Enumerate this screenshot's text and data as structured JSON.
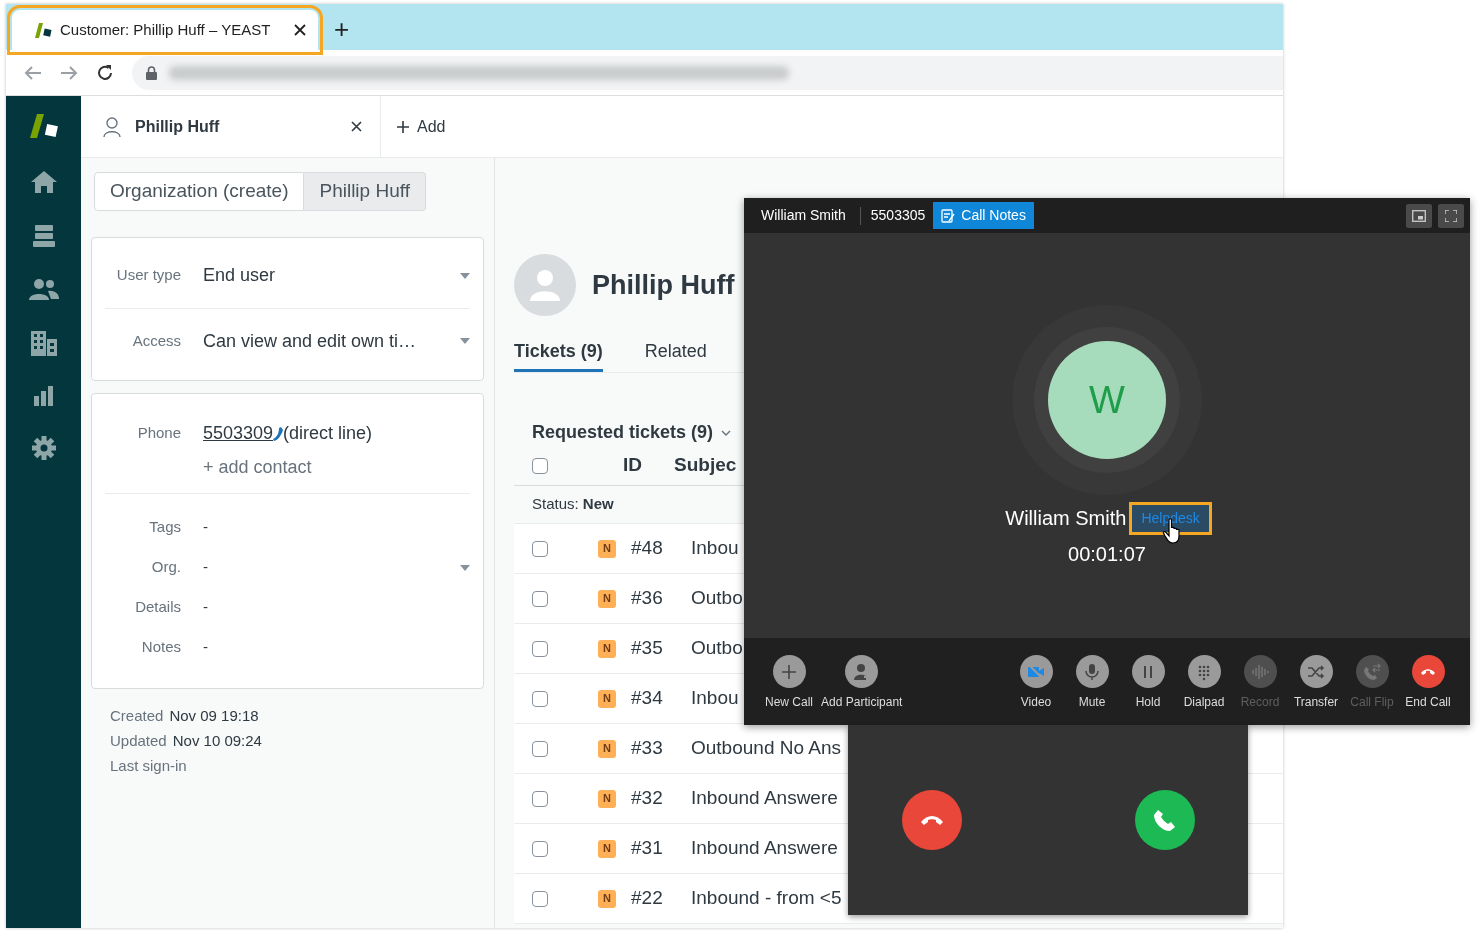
{
  "browser": {
    "tab": {
      "title": "Customer: Phillip Huff – YEAST",
      "highlighted": true
    },
    "new_tab": "+"
  },
  "header_tabs": [
    {
      "label": "Phillip Huff"
    }
  ],
  "add_tab": "Add",
  "breadcrumbs": [
    {
      "label": "Organization (create)",
      "selected": false
    },
    {
      "label": "Phillip Huff",
      "selected": true
    }
  ],
  "user_fields": [
    {
      "label": "User type",
      "value": "End user"
    },
    {
      "label": "Access",
      "value": "Can view and edit own ti…"
    }
  ],
  "contact": {
    "label": "Phone",
    "number": "5503309",
    "note": "(direct line)",
    "add": "+ add contact"
  },
  "details": [
    {
      "label": "Tags",
      "value": "-",
      "dropdown": false
    },
    {
      "label": "Org.",
      "value": "-",
      "dropdown": true
    },
    {
      "label": "Details",
      "value": "-",
      "dropdown": false
    },
    {
      "label": "Notes",
      "value": "-",
      "dropdown": false
    }
  ],
  "meta": [
    {
      "label": "Created",
      "value": "Nov 09 19:18"
    },
    {
      "label": "Updated",
      "value": "Nov 10 09:24"
    },
    {
      "label": "Last sign-in"
    }
  ],
  "profile": {
    "name": "Phillip Huff",
    "tabs": [
      {
        "label": "Tickets (9)",
        "selected": true
      },
      {
        "label": "Related",
        "selected": false
      }
    ]
  },
  "tickets": {
    "title": "Requested tickets (9)",
    "select_all_checked": false,
    "columns": [
      "ID",
      "Subjec"
    ],
    "group": {
      "label": "Status:",
      "value": "New"
    },
    "rows": [
      {
        "status": "N",
        "id": "#48",
        "subject": "Inbou",
        "checked": false
      },
      {
        "status": "N",
        "id": "#36",
        "subject": "Outbo",
        "checked": false
      },
      {
        "status": "N",
        "id": "#35",
        "subject": "Outbo",
        "checked": false
      },
      {
        "status": "N",
        "id": "#34",
        "subject": "Inbou",
        "checked": false
      },
      {
        "status": "N",
        "id": "#33",
        "subject": "Outbound No Ans",
        "checked": false
      },
      {
        "status": "N",
        "id": "#32",
        "subject": "Inbound Answere",
        "checked": false
      },
      {
        "status": "N",
        "id": "#31",
        "subject": "Inbound Answere",
        "checked": false
      },
      {
        "status": "N",
        "id": "#22",
        "subject": "Inbound - from <5",
        "checked": false
      }
    ]
  },
  "call": {
    "caller": "William Smith",
    "number": "5503305",
    "notes_button": "Call Notes",
    "avatar": "W",
    "name": "William Smith",
    "tag": {
      "label": "Helpdesk",
      "highlighted": true
    },
    "timer": "00:01:07",
    "actions_left": [
      {
        "kind": "new-call",
        "label": "New Call",
        "disabled": false
      },
      {
        "kind": "add-participant",
        "label": "Add Participant",
        "disabled": false
      }
    ],
    "actions_right": [
      {
        "kind": "video",
        "label": "Video",
        "disabled": false
      },
      {
        "kind": "mute",
        "label": "Mute",
        "disabled": false
      },
      {
        "kind": "hold",
        "label": "Hold",
        "disabled": false
      },
      {
        "kind": "dialpad",
        "label": "Dialpad",
        "disabled": false
      },
      {
        "kind": "record",
        "label": "Record",
        "disabled": true
      },
      {
        "kind": "transfer",
        "label": "Transfer",
        "disabled": false
      },
      {
        "kind": "call-flip",
        "label": "Call Flip",
        "disabled": true
      },
      {
        "kind": "end-call",
        "label": "End Call",
        "disabled": false
      }
    ]
  }
}
